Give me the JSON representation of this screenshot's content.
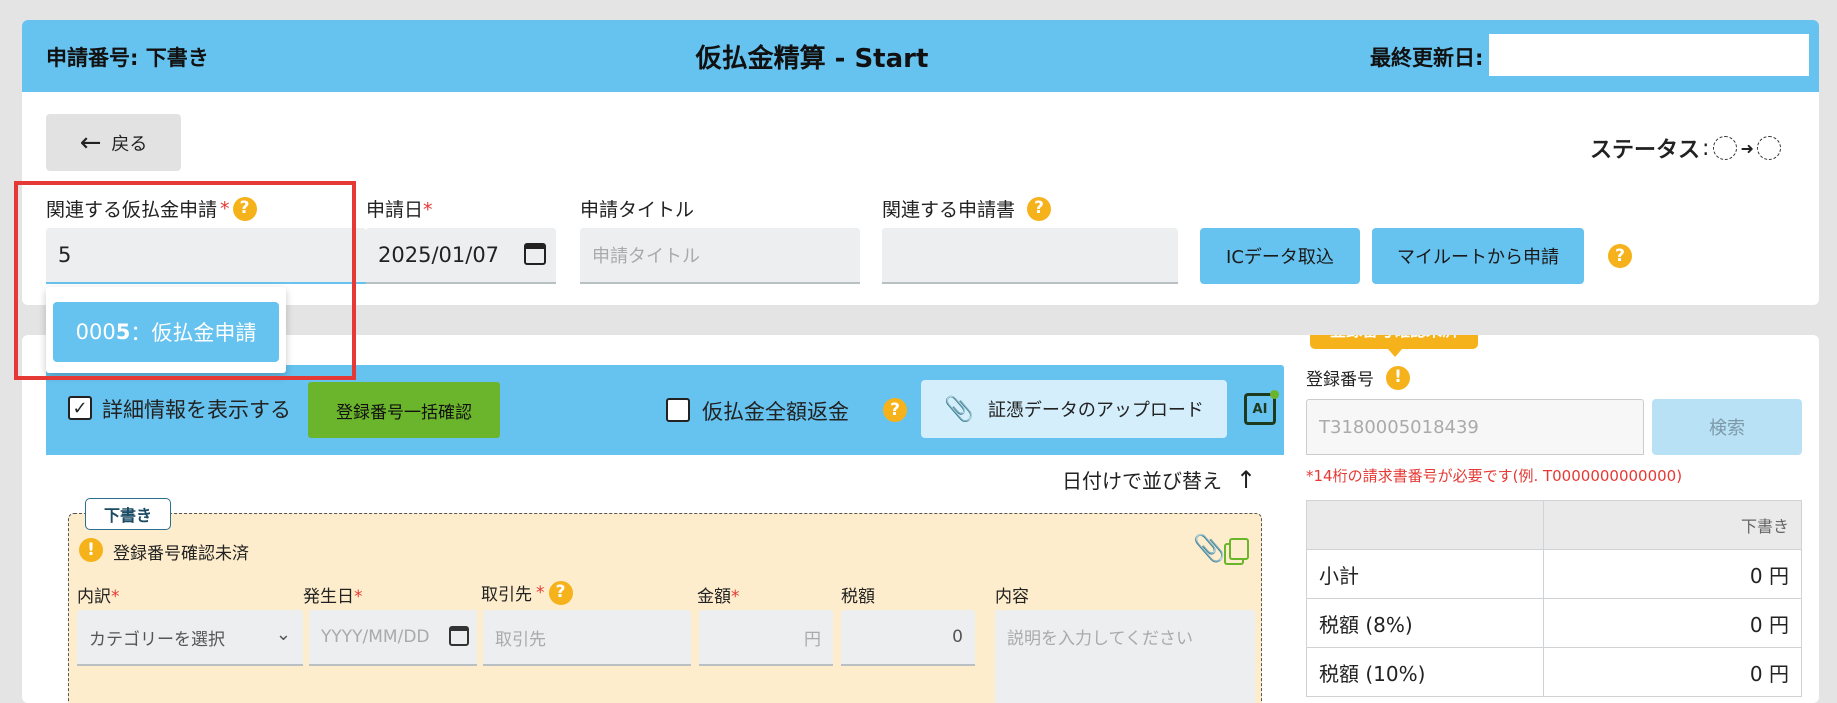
{
  "header": {
    "request_no_label": "申請番号:",
    "request_no_value": "下書き",
    "title": "仮払金精算 - Start",
    "last_updated_label": "最終更新日:",
    "last_updated_value": ""
  },
  "toolbar": {
    "back_label": "戻る",
    "status_label": "ステータス",
    "status_colon": ":"
  },
  "form": {
    "related_advance": {
      "label": "関連する仮払金申請",
      "value": "5"
    },
    "request_date": {
      "label": "申請日",
      "value": "2025/01/07"
    },
    "request_title": {
      "label": "申請タイトル",
      "placeholder": "申請タイトル"
    },
    "related_doc": {
      "label": "関連する申請書",
      "value": ""
    },
    "ic_button": "ICデータ取込",
    "myroute_button": "マイルートから申請",
    "dropdown_option_prefix": "000",
    "dropdown_option_match": "5",
    "dropdown_option_rest": "：仮払金申請"
  },
  "detail_bar": {
    "show_detail_label": "詳細情報を表示する",
    "bulk_confirm_button": "登録番号一括確認",
    "full_refund_label": "仮払金全額返金",
    "upload_button": "証憑データのアップロード",
    "ai_label": "AI"
  },
  "list": {
    "sort_label": "日付けで並び替え"
  },
  "entry": {
    "status_tag": "下書き",
    "warning_text": "登録番号確認未済",
    "cols": {
      "category": "内訳",
      "date": "発生日",
      "vendor": "取引先",
      "amount": "金額",
      "tax": "税額",
      "desc": "内容"
    },
    "category_placeholder": "カテゴリーを選択",
    "date_placeholder": "YYYY/MM/DD",
    "vendor_placeholder": "取引先",
    "amount_unit": "円",
    "tax_value": "0",
    "desc_placeholder": "説明を入力してください"
  },
  "registration": {
    "tooltip": "登録番号確認未済",
    "label": "登録番号",
    "placeholder": "T3180005018439",
    "search_button": "検索",
    "hint": "*14桁の請求書番号が必要です(例. T0000000000000)"
  },
  "summary": {
    "header_col": "下書き",
    "rows": [
      {
        "label": "小計",
        "value": "0 円"
      },
      {
        "label": "税額 (8%)",
        "value": "0 円"
      },
      {
        "label": "税額 (10%)",
        "value": "0 円"
      }
    ]
  },
  "colors": {
    "accent_blue": "#66c2ee",
    "green_button": "#6bb52c",
    "warning_orange": "#f6b21b",
    "highlight_red": "#e53935",
    "entry_bg": "#fdedcc"
  }
}
